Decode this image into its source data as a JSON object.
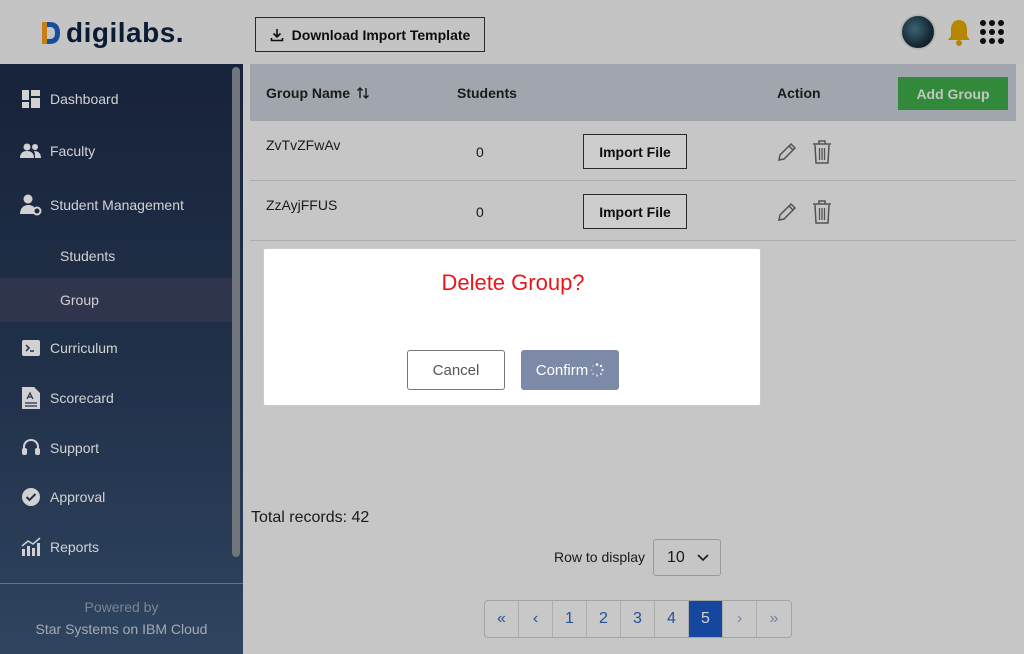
{
  "header": {
    "logo_text": "digilabs.",
    "download_button_label": "Download Import Template"
  },
  "sidebar": {
    "items": [
      {
        "label": "Dashboard",
        "icon": "dashboard-icon"
      },
      {
        "label": "Faculty",
        "icon": "faculty-icon"
      },
      {
        "label": "Student Management",
        "icon": "student-management-icon"
      },
      {
        "label": "Students",
        "icon": ""
      },
      {
        "label": "Group",
        "icon": "",
        "active": true
      },
      {
        "label": "Curriculum",
        "icon": "terminal-icon"
      },
      {
        "label": "Scorecard",
        "icon": "scorecard-icon"
      },
      {
        "label": "Support",
        "icon": "headset-icon"
      },
      {
        "label": "Approval",
        "icon": "check-circle-icon"
      },
      {
        "label": "Reports",
        "icon": "reports-icon"
      }
    ],
    "powered_by": "Powered by",
    "powered_by_company": "Star Systems on IBM Cloud"
  },
  "table": {
    "headers": {
      "group_name": "Group Name",
      "sort_icon": "sort-arrows-icon",
      "students": "Students",
      "action": "Action"
    },
    "add_group_label": "Add Group",
    "rows": [
      {
        "name": "ZvTvZFwAv",
        "students": "0",
        "import_label": "Import File"
      },
      {
        "name": "ZzAyjFFUS",
        "students": "0",
        "import_label": "Import File"
      }
    ]
  },
  "footer": {
    "total_records": "Total records: 42",
    "row_display_label": "Row to display",
    "rows_per_page": "10",
    "pages": [
      "«",
      "‹",
      "1",
      "2",
      "3",
      "4",
      "5",
      "›",
      "»"
    ],
    "active_page": "5"
  },
  "modal": {
    "title": "Delete Group?",
    "cancel_label": "Cancel",
    "confirm_label": "Confirm"
  },
  "colors": {
    "accent_green": "#3da847",
    "title_red": "#e8161b",
    "pager_active": "#1b57c2",
    "sidebar_dark": "#1d2b47"
  }
}
